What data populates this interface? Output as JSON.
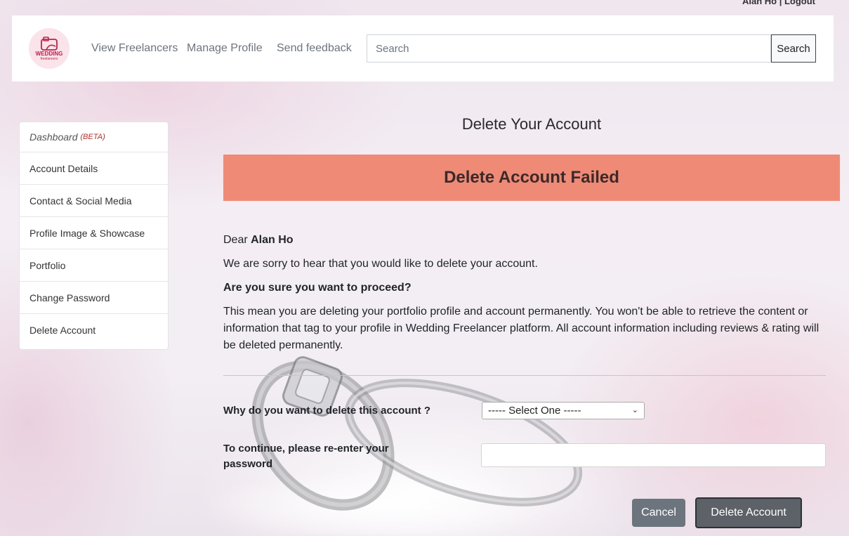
{
  "header": {
    "user_links": "Alan Ho  | Logout",
    "logo": {
      "text": "WEDDING",
      "sub": "freelancers",
      "icon": "camera-icon"
    },
    "nav": {
      "view_freelancers": "View Freelancers",
      "manage_profile": "Manage Profile",
      "send_feedback": "Send feedback"
    },
    "search": {
      "placeholder": "Search",
      "button": "Search"
    }
  },
  "sidebar": {
    "items": [
      {
        "label": "Dashboard",
        "badge": "(BETA)"
      },
      {
        "label": "Account Details"
      },
      {
        "label": "Contact & Social Media"
      },
      {
        "label": "Profile Image & Showcase"
      },
      {
        "label": "Portfolio"
      },
      {
        "label": "Change Password"
      },
      {
        "label": "Delete Account"
      }
    ]
  },
  "main": {
    "title": "Delete Your Account",
    "alert": "Delete Account Failed",
    "greeting_prefix": "Dear ",
    "user_name": "Alan Ho",
    "sorry_text": "We are sorry to hear that you would like to delete your account.",
    "confirm_question": "Are you sure you want to proceed?",
    "warning_text": "This mean you are deleting your portfolio profile and account permanently. You won't be able to retrieve the content or information that tag to your profile in Wedding Freelancer platform. All account information including reviews & rating will be deleted permanently.",
    "reason_label": "Why do you want to delete this account ?",
    "reason_selected": "----- Select One -----",
    "password_label": "To continue, please re-enter your password",
    "password_value": "",
    "cancel_button": "Cancel",
    "delete_button": "Delete Account"
  },
  "colors": {
    "alert_bg": "#ef8a76",
    "beta": "#c0302a",
    "cancel_bg": "#6c757d",
    "delete_bg": "#5d6268"
  }
}
